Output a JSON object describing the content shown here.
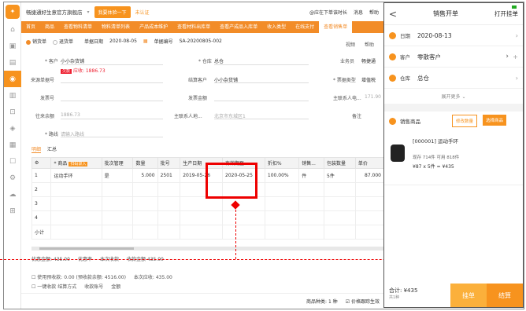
{
  "topbar": {
    "shop": "畅捷通好生意官方旗舰店",
    "trial": "我要体验一下",
    "unverified": "未认证",
    "promo": "@应在下单该时长",
    "message": "消息",
    "help": "帮助"
  },
  "nav": {
    "tabs": [
      "首页",
      "商品",
      "查看物料清单",
      "物料清单列表",
      "产品成本维护",
      "查看材料出库单",
      "查看产成品入库单",
      "收入类型",
      "在线支付",
      "查看销售单"
    ]
  },
  "form": {
    "radio_sale": "销货单",
    "radio_return": "退货单",
    "date_label": "单据日期",
    "date_value": "2020-08-05",
    "code_label": "单据编号",
    "code_value": "SA-20200805-002",
    "video": "视频",
    "help": "帮助",
    "customer_label": "客户",
    "customer_value": "小小杂货铺",
    "debt_label": "欠款",
    "debt_value": "应收: 1886.73",
    "warehouse_label": "仓库",
    "warehouse_value": "总仓",
    "salesman_label": "业务员",
    "salesman_value": "畅捷通",
    "source_label": "来源单据号",
    "settle_label": "结算客户",
    "settle_value": "小小杂货铺",
    "invoice_type_label": "票据类型",
    "invoice_type_value": "增值税",
    "invoice_no_label": "发票号",
    "invoice_amount_label": "发票金额",
    "contact_label": "主联系人电...",
    "contact_value": "171.90",
    "prev_debt_label": "往来余额",
    "prev_debt_value": "1886.73",
    "address_label": "主联系人地...",
    "address_placeholder": "北京市东城区1",
    "remark_label": "备注",
    "route_label": "路线",
    "route_placeholder": "请输入路线"
  },
  "detail_tabs": [
    "明细",
    "汇总"
  ],
  "table": {
    "headers": [
      "",
      "商品",
      "批次管理",
      "数量",
      "批号",
      "生产日期",
      "有效期至",
      "折扣%",
      "销售...",
      "包装数量",
      "单价"
    ],
    "scan_badge": "扫码录入",
    "rows": [
      [
        "1",
        "运动手环",
        "是",
        "5.000",
        "2501",
        "2019-05-26",
        "2020-05-25",
        "100.00%",
        "件",
        "5件",
        "87.000"
      ],
      [
        "2",
        "",
        "",
        "",
        "",
        "",
        "",
        "",
        "",
        "",
        ""
      ],
      [
        "3",
        "",
        "",
        "",
        "",
        "",
        "",
        "",
        "",
        "",
        ""
      ],
      [
        "4",
        "",
        "",
        "",
        "",
        "",
        "",
        "",
        "",
        "",
        ""
      ]
    ],
    "subtotal": "小计"
  },
  "summary": {
    "line1": [
      "优惠金额: 435.00",
      "优惠率",
      "本次收款",
      "收款金额 435.00"
    ],
    "line2": [
      "使用预收款: 0.00 (预收款余额: 4516.00)",
      "本次应收: 435.00"
    ],
    "line3": [
      "一键收款 结算方式",
      "收款账号",
      "金额"
    ],
    "footer_count": "商品种类: 1 种",
    "footer_check": "价格跟踪生效"
  },
  "mobile": {
    "back": "<",
    "title": "销售开单",
    "hold": "打开挂单",
    "date_label": "日期",
    "date_value": "2020-08-13",
    "customer_label": "客户",
    "customer_value": "零散客户",
    "warehouse_label": "仓库",
    "warehouse_value": "总仓",
    "expand": "展开更多",
    "goods_label": "销售商品",
    "scan_btn": "修改数量",
    "select_btn": "选择商品",
    "item_name": "[000001] 运动手环",
    "item_stock": "现存 714件  可用 818件",
    "item_price": "¥87 x 5件 = ¥435",
    "total": "合计: ¥435",
    "total_sub": "共1种",
    "hold_btn": "挂单",
    "pay_btn": "结算"
  }
}
